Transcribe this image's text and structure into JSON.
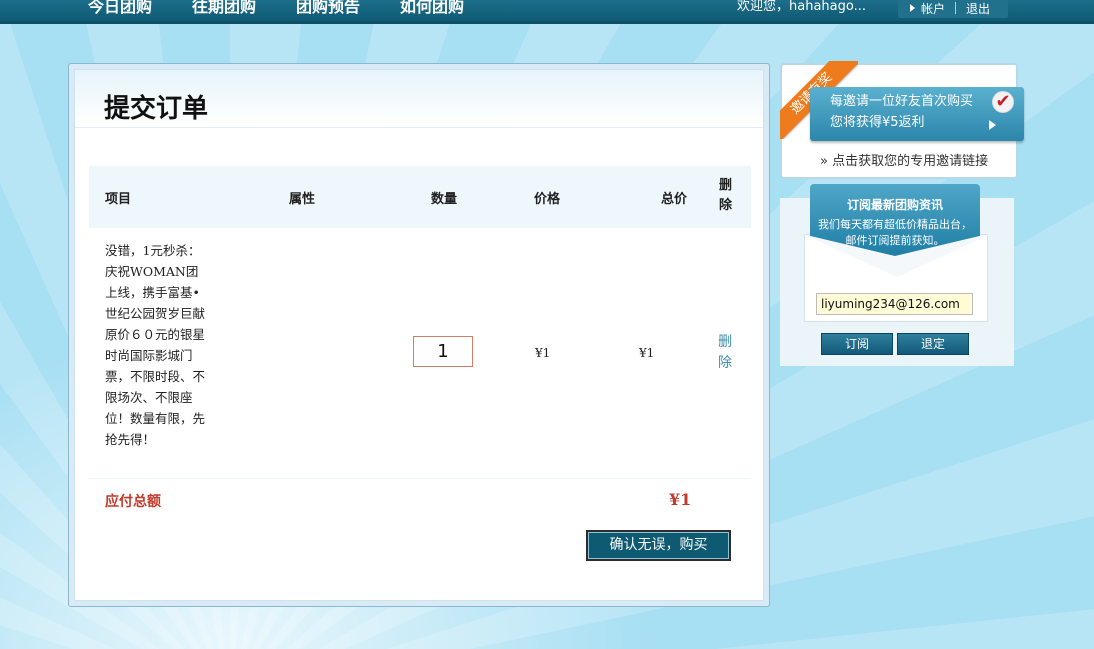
{
  "nav": {
    "items": [
      "今日团购",
      "往期团购",
      "团购预告",
      "如何团购"
    ],
    "welcome": "欢迎您，hahahago...",
    "account": "帐户",
    "logout": "退出"
  },
  "order": {
    "title": "提交订单",
    "headers": {
      "item": "项目",
      "attribute": "属性",
      "quantity": "数量",
      "price": "价格",
      "total": "总价",
      "delete": "删除"
    },
    "row": {
      "name": "没错，1元秒杀：庆祝WOMAN团上线，携手富基•世纪公园贺岁巨献原价６０元的银星时尚国际影城门票，不限时段、不限场次、不限座位！数量有限，先抢先得！",
      "quantity": "1",
      "price": "¥1",
      "total": "¥1",
      "delete": "删除"
    },
    "total_label": "应付总额",
    "total_value": "¥1",
    "confirm": "确认无误，购买"
  },
  "invite": {
    "ribbon": "邀请有奖",
    "line1": "每邀请一位好友首次购买",
    "line2": "您将获得¥5返利",
    "link": "» 点击获取您的专用邀请链接"
  },
  "subscribe": {
    "title": "订阅最新团购资讯",
    "desc": "我们每天都有超低价精品出台，邮件订阅提前获知。",
    "email": "liyuming234@126.com",
    "subscribe_btn": "订阅",
    "unsubscribe_btn": "退定"
  },
  "colors": {
    "accent": "#0e5a72",
    "price_red": "#c23a2a",
    "ribbon_orange": "#ee7b1c"
  }
}
